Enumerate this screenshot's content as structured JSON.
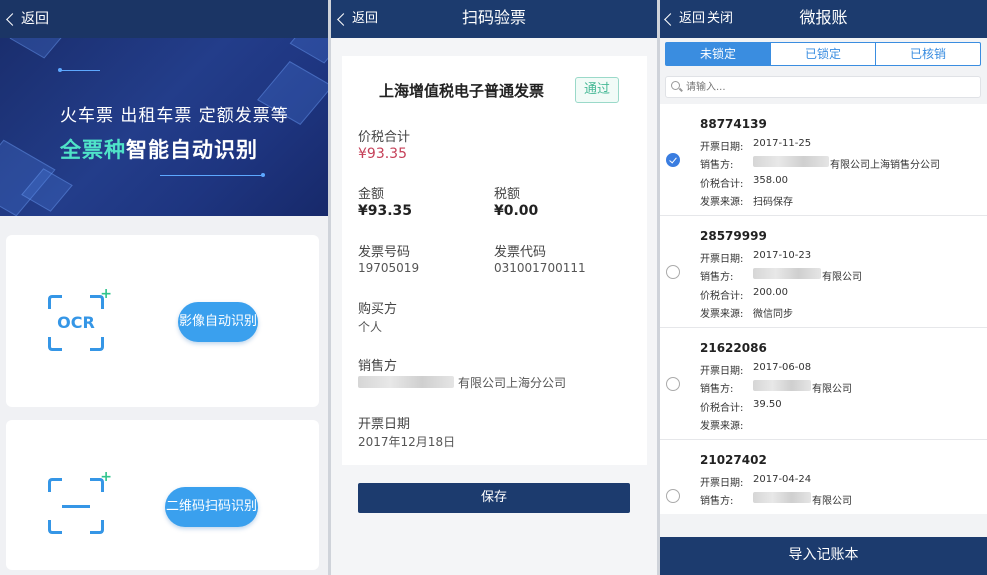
{
  "panel_ocr": {
    "back_label": "返回",
    "banner": {
      "line1": "火车票  出租车票  定额发票等",
      "line2_highlight": "全票种",
      "line2_rest": "智能自动识别"
    },
    "ocr_icon_text": "OCR",
    "ocr_button": "影像自动识别",
    "qr_button": "二维码扫码识别"
  },
  "panel_verify": {
    "back_label": "返回",
    "title": "扫码验票",
    "invoice_title": "上海增值税电子普通发票",
    "status_badge": "通过",
    "fields": {
      "total_label": "价税合计",
      "total_value": "¥93.35",
      "amount_label": "金额",
      "amount_value": "¥93.35",
      "tax_label": "税额",
      "tax_value": "¥0.00",
      "invoice_no_label": "发票号码",
      "invoice_no_value": "19705019",
      "invoice_code_label": "发票代码",
      "invoice_code_value": "031001700111",
      "buyer_label": "购买方",
      "buyer_value": "个人",
      "seller_label": "销售方",
      "seller_value_suffix": "有限公司上海分公司",
      "date_label": "开票日期",
      "date_value": "2017年12月18日"
    },
    "save_button": "保存"
  },
  "panel_list": {
    "back_label": "返回",
    "close_label": "关闭",
    "title": "微报账",
    "tabs": [
      "未锁定",
      "已锁定",
      "已核销"
    ],
    "active_tab": 0,
    "search_placeholder": "请输入...",
    "labels": {
      "date": "开票日期:",
      "seller": "销售方:",
      "total": "价税合计:",
      "source": "发票来源:"
    },
    "items": [
      {
        "no": "88774139",
        "date": "2017-11-25",
        "seller_suffix": "有限公司上海销售分公司",
        "total": "358.00",
        "source": "扫码保存",
        "checked": true
      },
      {
        "no": "28579999",
        "date": "2017-10-23",
        "seller_suffix": "有限公司",
        "total": "200.00",
        "source": "微信同步",
        "checked": false
      },
      {
        "no": "21622086",
        "date": "2017-06-08",
        "seller_suffix": "有限公司",
        "total": "39.50",
        "source": "",
        "checked": false
      },
      {
        "no": "21027402",
        "date": "2017-04-24",
        "seller_suffix": "有限公司",
        "total": "",
        "source": "",
        "checked": false
      }
    ],
    "import_button": "导入记账本"
  },
  "colors": {
    "navbar": "#1c3b6e",
    "accent_blue": "#3a8de0",
    "pill_blue": "#3aa0ee",
    "pass_green": "#46b996",
    "price_red": "#c54058",
    "highlight_teal": "#4fe3c8"
  }
}
